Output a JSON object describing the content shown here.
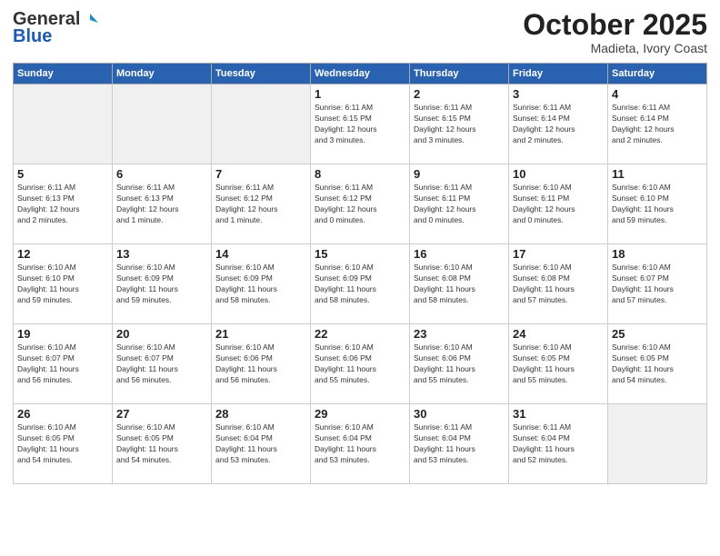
{
  "header": {
    "logo_general": "General",
    "logo_blue": "Blue",
    "month": "October 2025",
    "location": "Madieta, Ivory Coast"
  },
  "weekdays": [
    "Sunday",
    "Monday",
    "Tuesday",
    "Wednesday",
    "Thursday",
    "Friday",
    "Saturday"
  ],
  "weeks": [
    [
      {
        "day": "",
        "info": ""
      },
      {
        "day": "",
        "info": ""
      },
      {
        "day": "",
        "info": ""
      },
      {
        "day": "1",
        "info": "Sunrise: 6:11 AM\nSunset: 6:15 PM\nDaylight: 12 hours\nand 3 minutes."
      },
      {
        "day": "2",
        "info": "Sunrise: 6:11 AM\nSunset: 6:15 PM\nDaylight: 12 hours\nand 3 minutes."
      },
      {
        "day": "3",
        "info": "Sunrise: 6:11 AM\nSunset: 6:14 PM\nDaylight: 12 hours\nand 2 minutes."
      },
      {
        "day": "4",
        "info": "Sunrise: 6:11 AM\nSunset: 6:14 PM\nDaylight: 12 hours\nand 2 minutes."
      }
    ],
    [
      {
        "day": "5",
        "info": "Sunrise: 6:11 AM\nSunset: 6:13 PM\nDaylight: 12 hours\nand 2 minutes."
      },
      {
        "day": "6",
        "info": "Sunrise: 6:11 AM\nSunset: 6:13 PM\nDaylight: 12 hours\nand 1 minute."
      },
      {
        "day": "7",
        "info": "Sunrise: 6:11 AM\nSunset: 6:12 PM\nDaylight: 12 hours\nand 1 minute."
      },
      {
        "day": "8",
        "info": "Sunrise: 6:11 AM\nSunset: 6:12 PM\nDaylight: 12 hours\nand 0 minutes."
      },
      {
        "day": "9",
        "info": "Sunrise: 6:11 AM\nSunset: 6:11 PM\nDaylight: 12 hours\nand 0 minutes."
      },
      {
        "day": "10",
        "info": "Sunrise: 6:10 AM\nSunset: 6:11 PM\nDaylight: 12 hours\nand 0 minutes."
      },
      {
        "day": "11",
        "info": "Sunrise: 6:10 AM\nSunset: 6:10 PM\nDaylight: 11 hours\nand 59 minutes."
      }
    ],
    [
      {
        "day": "12",
        "info": "Sunrise: 6:10 AM\nSunset: 6:10 PM\nDaylight: 11 hours\nand 59 minutes."
      },
      {
        "day": "13",
        "info": "Sunrise: 6:10 AM\nSunset: 6:09 PM\nDaylight: 11 hours\nand 59 minutes."
      },
      {
        "day": "14",
        "info": "Sunrise: 6:10 AM\nSunset: 6:09 PM\nDaylight: 11 hours\nand 58 minutes."
      },
      {
        "day": "15",
        "info": "Sunrise: 6:10 AM\nSunset: 6:09 PM\nDaylight: 11 hours\nand 58 minutes."
      },
      {
        "day": "16",
        "info": "Sunrise: 6:10 AM\nSunset: 6:08 PM\nDaylight: 11 hours\nand 58 minutes."
      },
      {
        "day": "17",
        "info": "Sunrise: 6:10 AM\nSunset: 6:08 PM\nDaylight: 11 hours\nand 57 minutes."
      },
      {
        "day": "18",
        "info": "Sunrise: 6:10 AM\nSunset: 6:07 PM\nDaylight: 11 hours\nand 57 minutes."
      }
    ],
    [
      {
        "day": "19",
        "info": "Sunrise: 6:10 AM\nSunset: 6:07 PM\nDaylight: 11 hours\nand 56 minutes."
      },
      {
        "day": "20",
        "info": "Sunrise: 6:10 AM\nSunset: 6:07 PM\nDaylight: 11 hours\nand 56 minutes."
      },
      {
        "day": "21",
        "info": "Sunrise: 6:10 AM\nSunset: 6:06 PM\nDaylight: 11 hours\nand 56 minutes."
      },
      {
        "day": "22",
        "info": "Sunrise: 6:10 AM\nSunset: 6:06 PM\nDaylight: 11 hours\nand 55 minutes."
      },
      {
        "day": "23",
        "info": "Sunrise: 6:10 AM\nSunset: 6:06 PM\nDaylight: 11 hours\nand 55 minutes."
      },
      {
        "day": "24",
        "info": "Sunrise: 6:10 AM\nSunset: 6:05 PM\nDaylight: 11 hours\nand 55 minutes."
      },
      {
        "day": "25",
        "info": "Sunrise: 6:10 AM\nSunset: 6:05 PM\nDaylight: 11 hours\nand 54 minutes."
      }
    ],
    [
      {
        "day": "26",
        "info": "Sunrise: 6:10 AM\nSunset: 6:05 PM\nDaylight: 11 hours\nand 54 minutes."
      },
      {
        "day": "27",
        "info": "Sunrise: 6:10 AM\nSunset: 6:05 PM\nDaylight: 11 hours\nand 54 minutes."
      },
      {
        "day": "28",
        "info": "Sunrise: 6:10 AM\nSunset: 6:04 PM\nDaylight: 11 hours\nand 53 minutes."
      },
      {
        "day": "29",
        "info": "Sunrise: 6:10 AM\nSunset: 6:04 PM\nDaylight: 11 hours\nand 53 minutes."
      },
      {
        "day": "30",
        "info": "Sunrise: 6:11 AM\nSunset: 6:04 PM\nDaylight: 11 hours\nand 53 minutes."
      },
      {
        "day": "31",
        "info": "Sunrise: 6:11 AM\nSunset: 6:04 PM\nDaylight: 11 hours\nand 52 minutes."
      },
      {
        "day": "",
        "info": ""
      }
    ]
  ]
}
